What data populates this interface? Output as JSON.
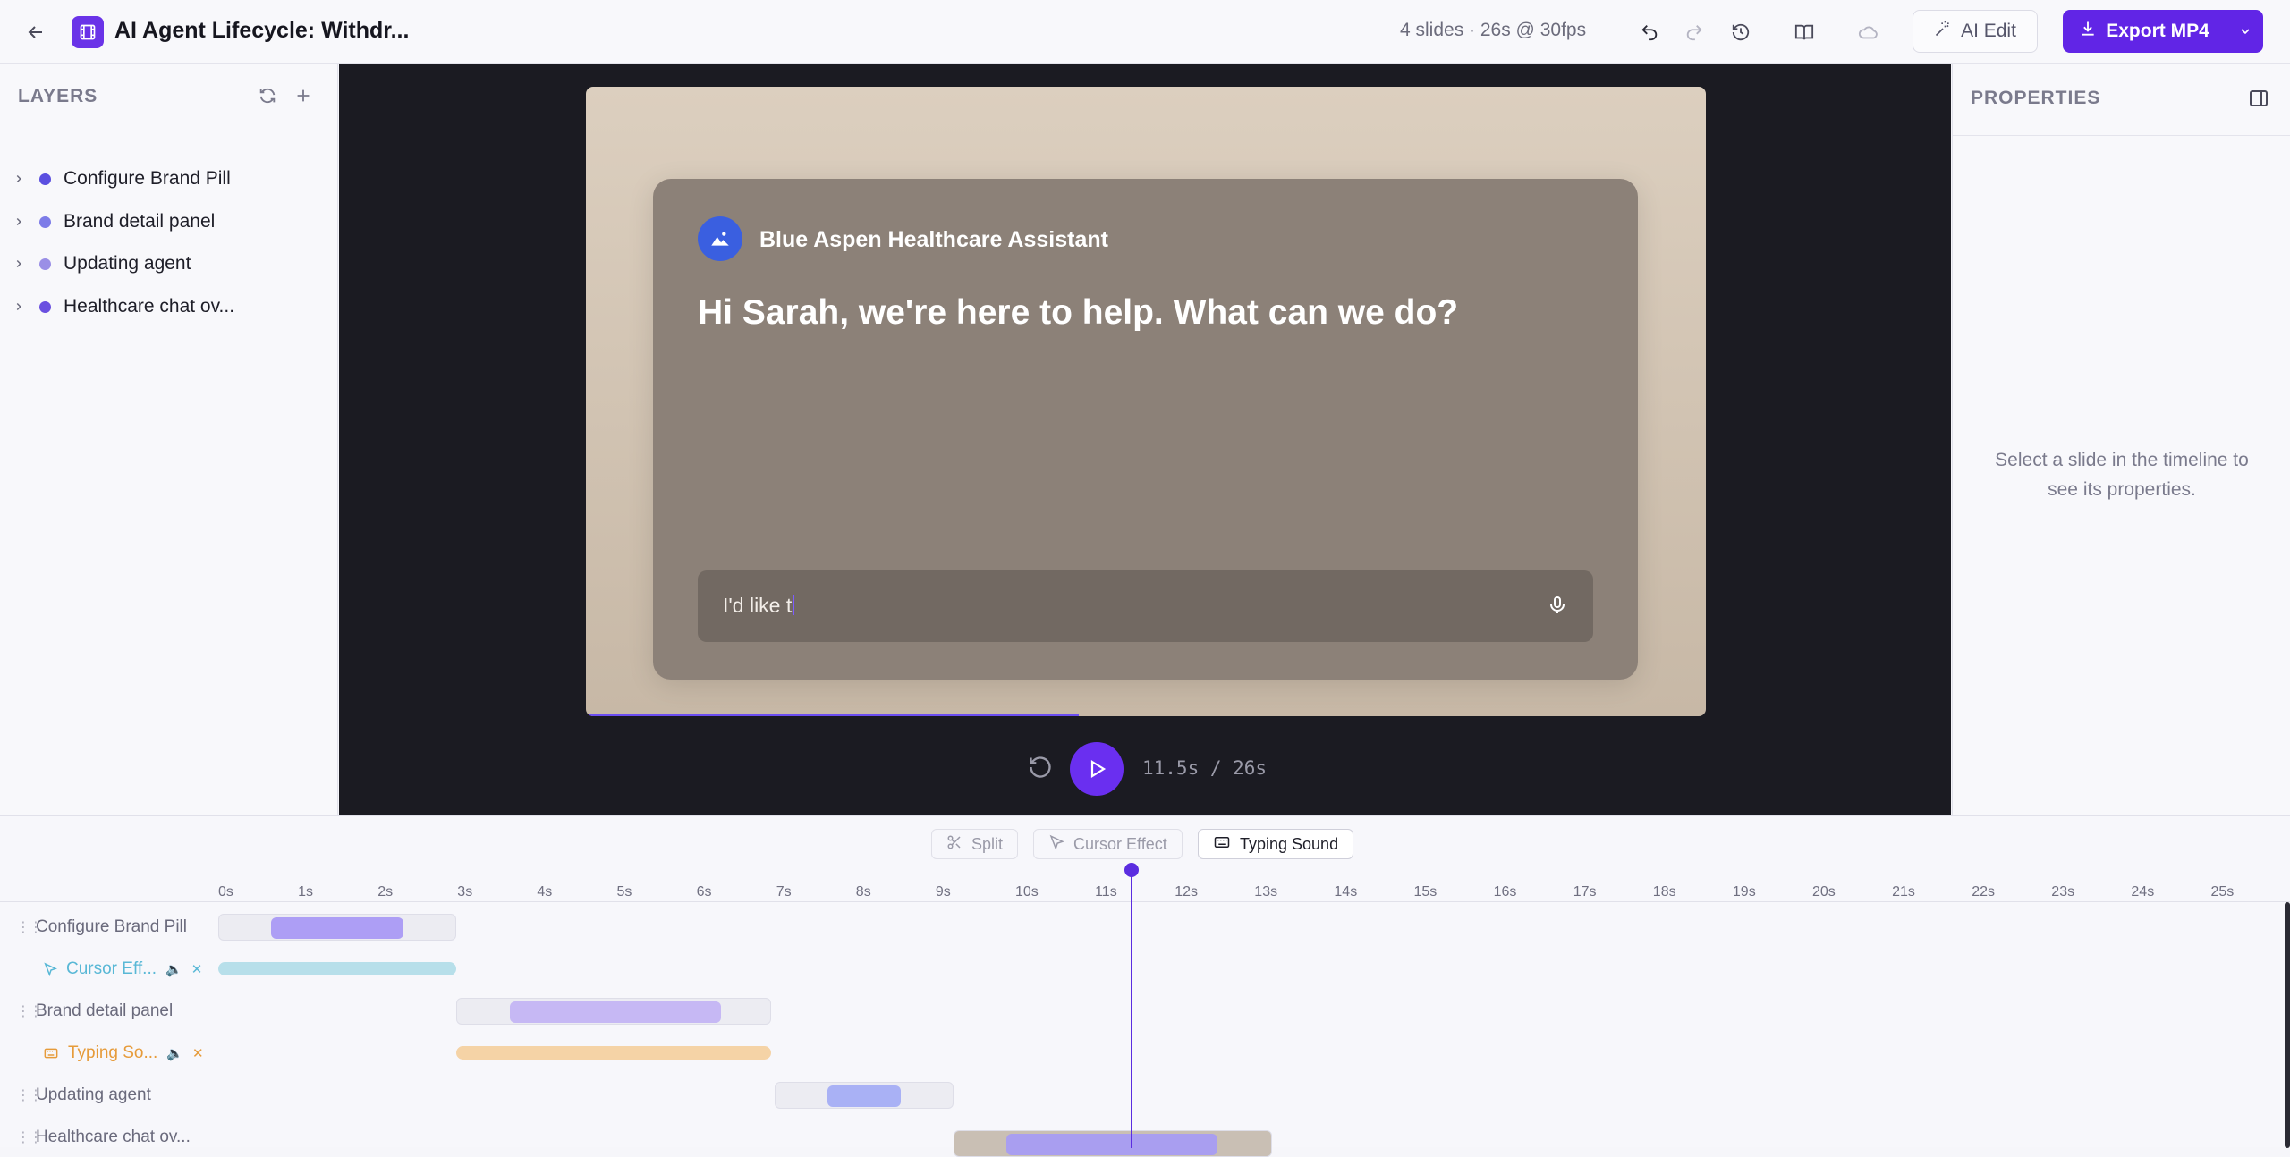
{
  "header": {
    "title": "AI Agent Lifecycle: Withdr...",
    "meta": "4 slides  ·  26s @ 30fps",
    "ai_edit_label": "AI Edit",
    "export_label": "Export MP4"
  },
  "layers": {
    "heading": "LAYERS",
    "items": [
      {
        "label": "Configure Brand Pill",
        "color": "#5b4fe0"
      },
      {
        "label": "Brand detail panel",
        "color": "#7d7ce8"
      },
      {
        "label": "Updating agent",
        "color": "#9a8fe6"
      },
      {
        "label": "Healthcare chat ov...",
        "color": "#6a50e0"
      }
    ]
  },
  "preview": {
    "brand_name": "Blue Aspen Healthcare Assistant",
    "greeting": "Hi Sarah, we're here to help. What can we do?",
    "input_text": "I'd like t",
    "time": "11.5s / 26s",
    "progress": 0.44
  },
  "properties": {
    "heading": "PROPERTIES",
    "empty_text": "Select a slide in the timeline to see its properties."
  },
  "timeline": {
    "tools": {
      "split": "Split",
      "cursor": "Cursor Effect",
      "typing": "Typing Sound"
    },
    "ticks": [
      "0s",
      "1s",
      "2s",
      "3s",
      "4s",
      "5s",
      "6s",
      "7s",
      "8s",
      "9s",
      "10s",
      "11s",
      "12s",
      "13s",
      "14s",
      "15s",
      "16s",
      "17s",
      "18s",
      "19s",
      "20s",
      "21s",
      "22s",
      "23s",
      "24s",
      "25s"
    ],
    "tracks": {
      "t1": "Configure Brand Pill",
      "t1_sub": "Cursor Eff...",
      "t2": "Brand detail panel",
      "t2_sub": "Typing So...",
      "t3": "Updating agent",
      "t4": "Healthcare chat ov..."
    },
    "playhead_seconds": 11.5
  },
  "colors": {
    "accent": "#6125e6",
    "cursor_effect": "#b7dfea",
    "typing_sound": "#f5d3a6"
  }
}
